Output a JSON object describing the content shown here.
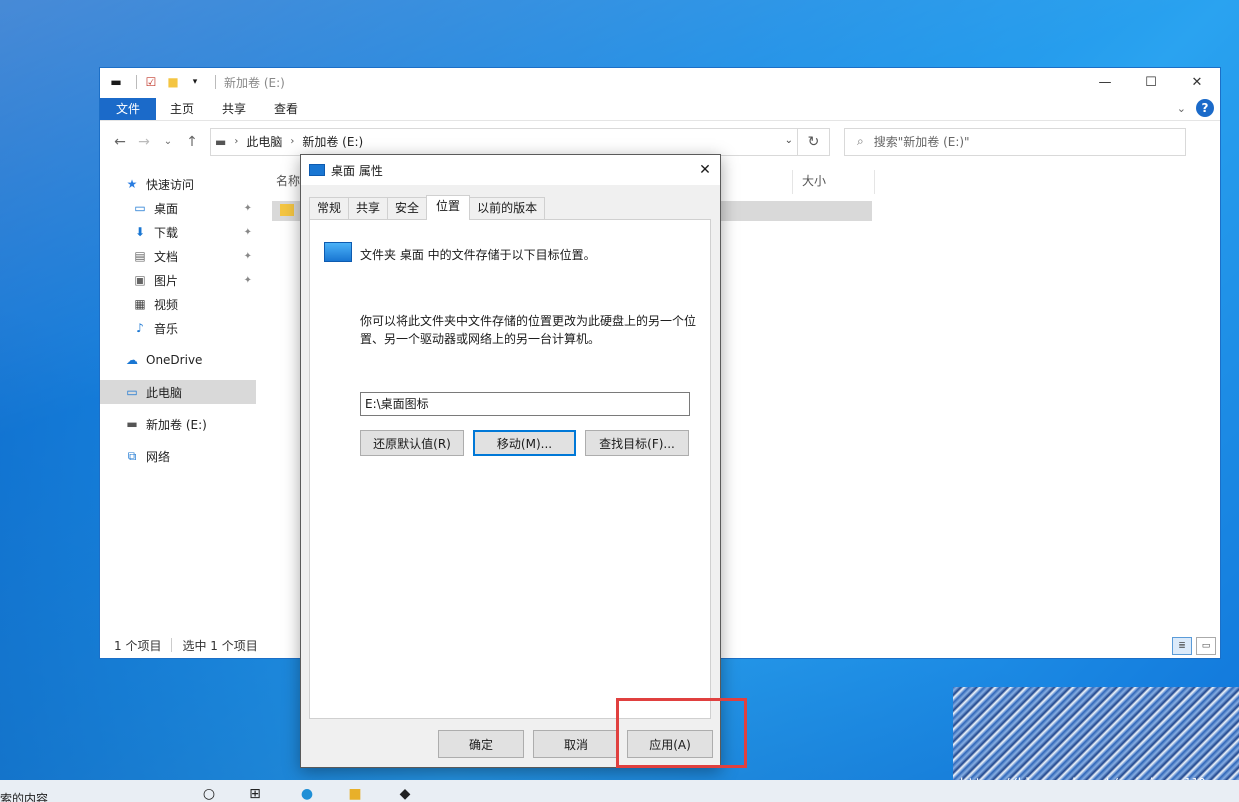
{
  "explorer": {
    "title": "新加卷 (E:)",
    "ribbon_tabs": [
      "文件",
      "主页",
      "共享",
      "查看"
    ],
    "breadcrumb": [
      "此电脑",
      "新加卷 (E:)"
    ],
    "search_placeholder": "搜索\"新加卷 (E:)\"",
    "columns": {
      "name": "名称",
      "size": "大小"
    },
    "nav": {
      "quick_access": "快速访问",
      "items": [
        "桌面",
        "下载",
        "文档",
        "图片",
        "视频",
        "音乐"
      ],
      "onedrive": "OneDrive",
      "this_pc": "此电脑",
      "drive": "新加卷 (E:)",
      "network": "网络"
    },
    "status": {
      "count": "1 个项目",
      "selected": "选中 1 个项目"
    }
  },
  "dialog": {
    "title": "桌面 属性",
    "tabs": [
      "常规",
      "共享",
      "安全",
      "位置",
      "以前的版本"
    ],
    "active_tab": "位置",
    "info_line": "文件夹 桌面 中的文件存储于以下目标位置。",
    "description": "你可以将此文件夹中文件存储的位置更改为此硬盘上的另一个位置、另一个驱动器或网络上的另一台计算机。",
    "path_value": "E:\\桌面图标",
    "buttons": {
      "restore": "还原默认值(R)",
      "move": "移动(M)...",
      "find": "查找目标(F)..."
    },
    "footer": {
      "ok": "确定",
      "cancel": "取消",
      "apply": "应用(A)"
    }
  },
  "taskbar": {
    "search_text": "索的内容"
  },
  "watermark": {
    "text": "https://blog.csdn.net/weixin_ng110"
  },
  "colors": {
    "accent": "#1b6ac9",
    "highlight": "#e0403f",
    "folder": "#1976d2"
  }
}
